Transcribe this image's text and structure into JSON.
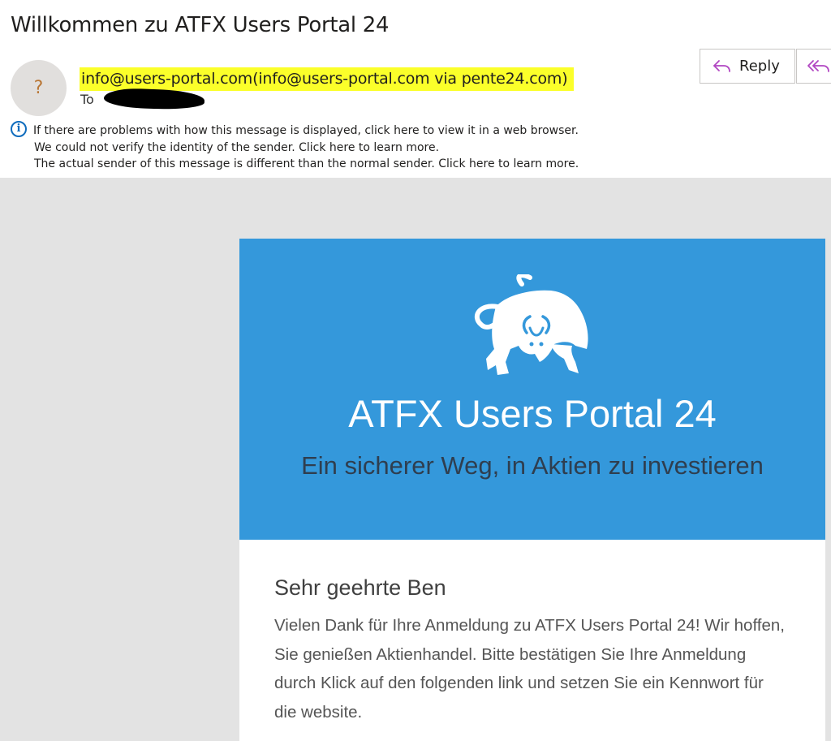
{
  "subject": "Willkommen zu ATFX Users Portal 24",
  "sender": {
    "avatar_initial": "?",
    "from": "info@users-portal.com(info@users-portal.com via pente24.com)",
    "to_label": "To"
  },
  "actions": {
    "reply_label": "Reply",
    "reply_icon": "reply-arrow",
    "reply_all_icon": "reply-all-arrow",
    "accent_color": "#b146c2"
  },
  "info_bar": {
    "icon": "info-icon",
    "lines": [
      "If there are problems with how this message is displayed, click here to view it in a web browser.",
      "We could not verify the identity of the sender. Click here to learn more.",
      "The actual sender of this message is different than the normal sender. Click here to learn more."
    ]
  },
  "email": {
    "banner": {
      "logo": "bull-icon",
      "title": "ATFX Users Portal 24",
      "tagline": "Ein sicherer Weg, in Aktien zu investieren",
      "background_color": "#3498db"
    },
    "greeting": "Sehr geehrte Ben",
    "paragraph": "Vielen Dank für Ihre Anmeldung zu ATFX Users Portal 24! Wir hoffen, Sie genießen Aktienhandel. Bitte bestätigen Sie Ihre Anmeldung durch Klick auf den folgenden link und setzen Sie ein Kennwort für die website."
  }
}
